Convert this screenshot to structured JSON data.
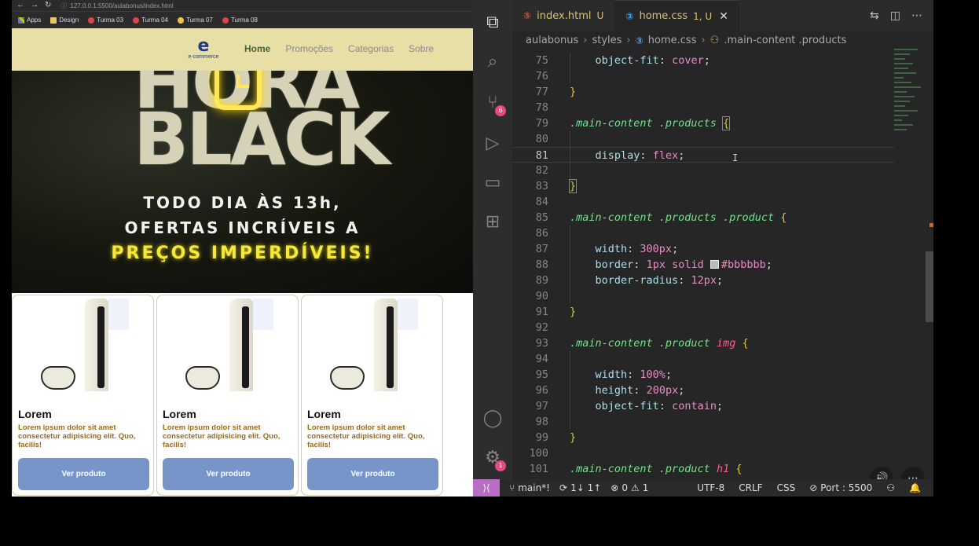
{
  "browser": {
    "url": "127.0.0.1:5500/aulabonus/index.html",
    "bookmarks": [
      "Apps",
      "Design",
      "Turma 03",
      "Turma 04",
      "Turma 07",
      "Turma 08"
    ]
  },
  "site": {
    "logo_text": "e-commerce",
    "nav": [
      "Home",
      "Promoções",
      "Categorias",
      "Sobre"
    ],
    "hero": {
      "line1": "HORA",
      "line2": "BLACK",
      "sub1": "TODO DIA ÀS 13h,",
      "sub2": "OFERTAS INCRÍVEIS A",
      "sub3": "PREÇOS IMPERDÍVEIS!"
    },
    "products": [
      {
        "title": "Lorem",
        "description": "Lorem ipsum dolor sit amet consectetur adipisicing elit. Quo, facilis!",
        "button": "Ver produto"
      },
      {
        "title": "Lorem",
        "description": "Lorem ipsum dolor sit amet consectetur adipisicing elit. Quo, facilis!",
        "button": "Ver produto"
      },
      {
        "title": "Lorem",
        "description": "Lorem ipsum dolor sit amet consectetur adipisicing elit. Quo, facilis!",
        "button": "Ver produto"
      }
    ]
  },
  "vscode": {
    "tabs": [
      {
        "name": "index.html",
        "status": "U"
      },
      {
        "name": "home.css",
        "status": "1, U"
      }
    ],
    "breadcrumb": [
      "aulabonus",
      "styles",
      "home.css",
      ".main-content .products"
    ],
    "badges": {
      "source_control": "6",
      "settings": "1"
    },
    "lines": [
      "75",
      "76",
      "77",
      "78",
      "79",
      "80",
      "81",
      "82",
      "83",
      "84",
      "85",
      "86",
      "87",
      "88",
      "89",
      "90",
      "91",
      "92",
      "93",
      "94",
      "95",
      "96",
      "97",
      "98",
      "99",
      "100",
      "101"
    ],
    "status": {
      "branch": "main*!",
      "sync": "1↓ 1↑",
      "errors": "0",
      "warnings": "1",
      "encoding": "UTF-8",
      "eol": "CRLF",
      "language": "CSS",
      "port": "Port : 5500"
    }
  }
}
